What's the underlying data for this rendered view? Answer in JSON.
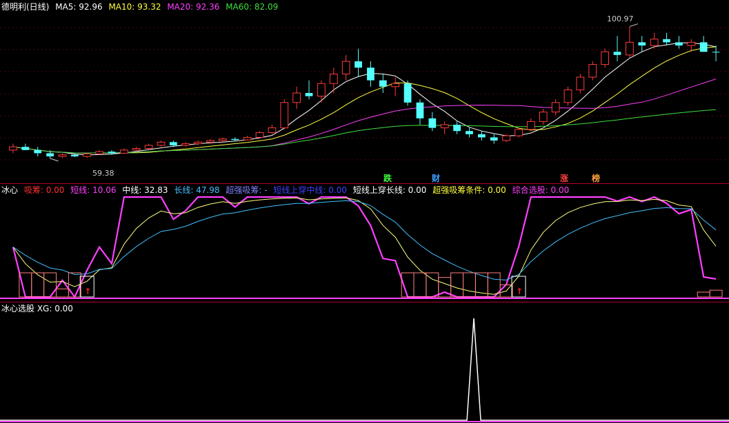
{
  "main": {
    "title": "德明利(日线)",
    "ma": [
      {
        "label": "MA5: 92.96",
        "color": "#ffffff"
      },
      {
        "label": "MA10: 93.32",
        "color": "#ffff40"
      },
      {
        "label": "MA20: 92.36",
        "color": "#ff40ff"
      },
      {
        "label": "MA60: 82.09",
        "color": "#40e040"
      }
    ],
    "high_label": "100.97",
    "low_label": "59.38",
    "tags": [
      {
        "text": "跌",
        "color": "#40ff40"
      },
      {
        "text": "财",
        "color": "#40a0ff"
      },
      {
        "text": "涨",
        "color": "#ff4040"
      },
      {
        "text": "榜",
        "color": "#ffa040"
      }
    ]
  },
  "indicator": {
    "name": "冰心",
    "items": [
      {
        "label": "吸筹: 0.00",
        "color": "#ff3030"
      },
      {
        "label": "短线: 10.06",
        "color": "#ff40ff"
      },
      {
        "label": "中线: 32.83",
        "color": "#ffffff"
      },
      {
        "label": "长线: 47.98",
        "color": "#40c0ff"
      },
      {
        "label": "超强吸筹: -",
        "color": "#8080ff"
      },
      {
        "label": "短线上穿中线: 0.00",
        "color": "#4040ff"
      },
      {
        "label": "短线上穿长线: 0.00",
        "color": "#ffffff"
      },
      {
        "label": "超强吸筹条件: 0.00",
        "color": "#ffff40"
      },
      {
        "label": "综合选股: 0.00",
        "color": "#ff40ff"
      }
    ]
  },
  "xg": {
    "label": "冰心选股 XG: 0.00"
  },
  "chart_data": {
    "type": "candlestick",
    "note_series": "Daily K-line with MA5/MA10/MA20/MA60 and BingXin indicator",
    "ohlc": [
      [
        62,
        64,
        61,
        63
      ],
      [
        63,
        64,
        62,
        62
      ],
      [
        62,
        63,
        60,
        61
      ],
      [
        61,
        62,
        59.38,
        60
      ],
      [
        60,
        61,
        59.5,
        60.5
      ],
      [
        60.5,
        61,
        59.8,
        60
      ],
      [
        60,
        61,
        59.5,
        60.8
      ],
      [
        60.8,
        62,
        60.5,
        61.5
      ],
      [
        61.5,
        62,
        60.5,
        61
      ],
      [
        61,
        62.5,
        60.8,
        62
      ],
      [
        62,
        63,
        61.5,
        62.5
      ],
      [
        62.5,
        64,
        62,
        63.5
      ],
      [
        63.5,
        65,
        63,
        64.5
      ],
      [
        64.5,
        65,
        63,
        63.5
      ],
      [
        63.5,
        64.5,
        63,
        64
      ],
      [
        64,
        65,
        63.5,
        64.5
      ],
      [
        64.5,
        65.5,
        64,
        65
      ],
      [
        65,
        66,
        64.5,
        65.5
      ],
      [
        65.5,
        66,
        64.8,
        65.2
      ],
      [
        65.2,
        66.5,
        65,
        66
      ],
      [
        66,
        68,
        65.5,
        67.5
      ],
      [
        67.5,
        70,
        67,
        69
      ],
      [
        69,
        78,
        68.5,
        77
      ],
      [
        77,
        82,
        75,
        80
      ],
      [
        80,
        84,
        78,
        79
      ],
      [
        79,
        84,
        77,
        83
      ],
      [
        83,
        88,
        80,
        86
      ],
      [
        86,
        92,
        84,
        90
      ],
      [
        90,
        94,
        85,
        88
      ],
      [
        88,
        90,
        82,
        84
      ],
      [
        84,
        86,
        80,
        82
      ],
      [
        82,
        85,
        79,
        83
      ],
      [
        83,
        84,
        76,
        77
      ],
      [
        77,
        78,
        70,
        72
      ],
      [
        72,
        74,
        68,
        69
      ],
      [
        69,
        71,
        67,
        70
      ],
      [
        70,
        71,
        67,
        68
      ],
      [
        68,
        69,
        66,
        67
      ],
      [
        67,
        68,
        65,
        66
      ],
      [
        66,
        67,
        64,
        65
      ],
      [
        65,
        67,
        64.5,
        66.5
      ],
      [
        66.5,
        69,
        66,
        68.5
      ],
      [
        68.5,
        72,
        68,
        71
      ],
      [
        71,
        75,
        70,
        74
      ],
      [
        74,
        78,
        73,
        77
      ],
      [
        77,
        82,
        76,
        81
      ],
      [
        81,
        86,
        80,
        85
      ],
      [
        85,
        90,
        84,
        89
      ],
      [
        89,
        94,
        88,
        93
      ],
      [
        93,
        98,
        90,
        92
      ],
      [
        92,
        100.97,
        91,
        96
      ],
      [
        96,
        98,
        93,
        95
      ],
      [
        95,
        99,
        94,
        97
      ],
      [
        97,
        99,
        95,
        96
      ],
      [
        96,
        98,
        94,
        95
      ],
      [
        95,
        97,
        93,
        96
      ],
      [
        96,
        98,
        94,
        93
      ],
      [
        93,
        95,
        90,
        92.9
      ]
    ],
    "ma_latest": {
      "MA5": 92.96,
      "MA10": 93.32,
      "MA20": 92.36,
      "MA60": 82.09
    },
    "indicator_latest": {
      "吸筹": 0.0,
      "短线": 10.06,
      "中线": 32.83,
      "长线": 47.98,
      "综合选股": 0.0
    },
    "xg_signal_index": 0.65
  }
}
